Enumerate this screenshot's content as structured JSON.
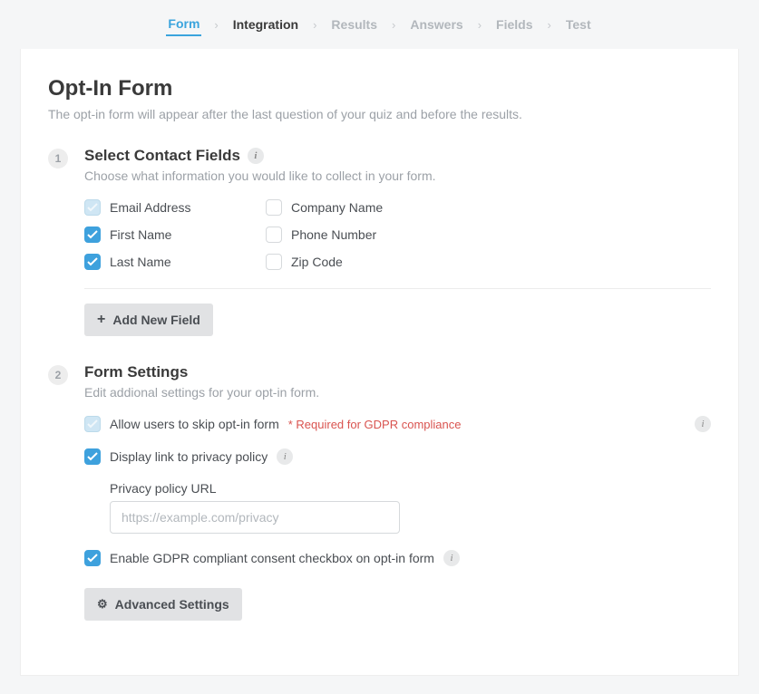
{
  "tabs": {
    "form": "Form",
    "integration": "Integration",
    "results": "Results",
    "answers": "Answers",
    "fields": "Fields",
    "test": "Test"
  },
  "header": {
    "title": "Opt-In Form",
    "subtitle": "The opt-in form will appear after the last question of your quiz and before the results."
  },
  "section1": {
    "step": "1",
    "title": "Select Contact Fields",
    "desc": "Choose what information you would like to collect in your form.",
    "fields": {
      "email": "Email Address",
      "first": "First Name",
      "last": "Last Name",
      "company": "Company Name",
      "phone": "Phone Number",
      "zip": "Zip Code"
    },
    "addNew": "Add New Field"
  },
  "section2": {
    "step": "2",
    "title": "Form Settings",
    "desc": "Edit addional settings for your opt-in form.",
    "allowSkip": "Allow users to skip opt-in form",
    "gdprReq": "* Required for GDPR compliance",
    "displayPriv": "Display link to privacy policy",
    "privLabel": "Privacy policy URL",
    "privPlaceholder": "https://example.com/privacy",
    "enableGdpr": "Enable GDPR compliant consent checkbox on opt-in form",
    "advanced": "Advanced Settings"
  }
}
